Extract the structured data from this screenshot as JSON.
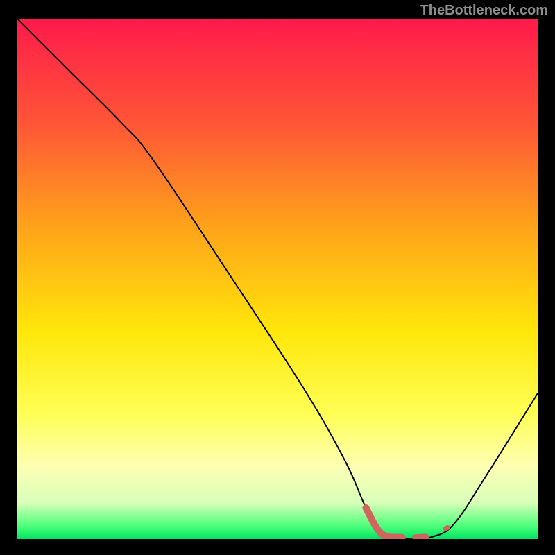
{
  "attribution": "TheBottleneck.com",
  "chart_data": {
    "type": "line",
    "title": "",
    "xlabel": "",
    "ylabel": "",
    "xlim": [
      0,
      100
    ],
    "ylim": [
      0,
      100
    ],
    "grid": false,
    "legend": false,
    "background_gradient_stops": [
      {
        "offset": 0.0,
        "color": "#ff1a4b"
      },
      {
        "offset": 0.2,
        "color": "#ff5537"
      },
      {
        "offset": 0.4,
        "color": "#ffa31a"
      },
      {
        "offset": 0.6,
        "color": "#ffe60a"
      },
      {
        "offset": 0.76,
        "color": "#ffff55"
      },
      {
        "offset": 0.86,
        "color": "#fdffb3"
      },
      {
        "offset": 0.93,
        "color": "#d8ffb8"
      },
      {
        "offset": 0.975,
        "color": "#4dff7a"
      },
      {
        "offset": 1.0,
        "color": "#00e562"
      }
    ],
    "series": [
      {
        "name": "bottleneck-curve",
        "stroke": "#000000",
        "stroke_width": 2,
        "points": [
          {
            "x": 0,
            "y": 100
          },
          {
            "x": 10,
            "y": 90
          },
          {
            "x": 20,
            "y": 80
          },
          {
            "x": 26,
            "y": 73
          },
          {
            "x": 40,
            "y": 52
          },
          {
            "x": 55,
            "y": 29
          },
          {
            "x": 63,
            "y": 15
          },
          {
            "x": 67,
            "y": 6
          },
          {
            "x": 70,
            "y": 1
          },
          {
            "x": 75,
            "y": 0
          },
          {
            "x": 80,
            "y": 0.5
          },
          {
            "x": 84,
            "y": 3
          },
          {
            "x": 90,
            "y": 12
          },
          {
            "x": 100,
            "y": 28
          }
        ]
      }
    ],
    "highlight_segments": [
      {
        "name": "optimal-zone-left",
        "stroke": "#d0645f",
        "stroke_width": 10,
        "linecap": "round",
        "points": [
          {
            "x": 67,
            "y": 6
          },
          {
            "x": 70,
            "y": 1
          },
          {
            "x": 74,
            "y": 0.3
          }
        ]
      },
      {
        "name": "optimal-zone-dot1",
        "stroke": "#d0645f",
        "stroke_width": 9,
        "linecap": "round",
        "points": [
          {
            "x": 76.5,
            "y": 0.3
          },
          {
            "x": 78.5,
            "y": 0.4
          }
        ]
      },
      {
        "name": "optimal-zone-dot2",
        "stroke": "#d0645f",
        "stroke_width": 7,
        "linecap": "round",
        "points": [
          {
            "x": 82.3,
            "y": 2.0
          },
          {
            "x": 82.7,
            "y": 2.2
          }
        ]
      }
    ]
  }
}
